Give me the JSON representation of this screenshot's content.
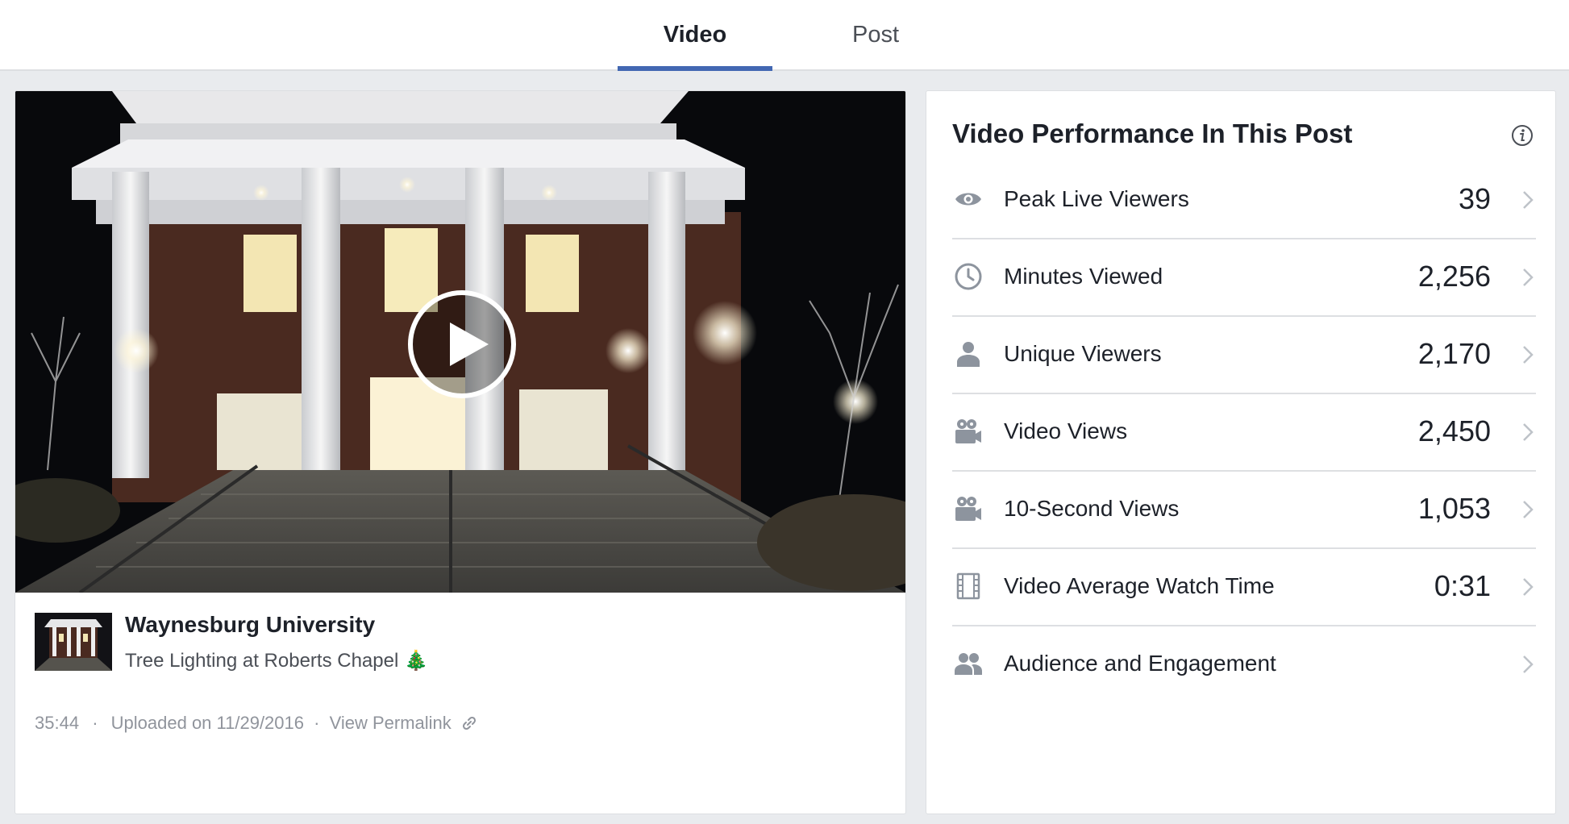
{
  "tabs": [
    {
      "label": "Video",
      "active": true
    },
    {
      "label": "Post",
      "active": false
    }
  ],
  "video": {
    "page_name": "Waynesburg University",
    "title": "Tree Lighting at Roberts Chapel 🎄",
    "duration": "35:44",
    "separator": "·",
    "uploaded": "Uploaded on 11/29/2016",
    "permalink": "View Permalink"
  },
  "performance": {
    "title": "Video Performance In This Post",
    "metrics": [
      {
        "label": "Peak Live Viewers",
        "value": "39",
        "icon": "eye-icon"
      },
      {
        "label": "Minutes Viewed",
        "value": "2,256",
        "icon": "clock-icon"
      },
      {
        "label": "Unique Viewers",
        "value": "2,170",
        "icon": "person-icon"
      },
      {
        "label": "Video Views",
        "value": "2,450",
        "icon": "video-camera-icon"
      },
      {
        "label": "10-Second Views",
        "value": "1,053",
        "icon": "video-camera-icon"
      },
      {
        "label": "Video Average Watch Time",
        "value": "0:31",
        "icon": "film-icon"
      },
      {
        "label": "Audience and Engagement",
        "value": "",
        "icon": "people-icon"
      }
    ]
  },
  "colors": {
    "accent": "#4267b2",
    "background": "#e9ebee",
    "text_primary": "#1d2129",
    "text_secondary": "#90949c",
    "icon_gray": "#8d949e"
  }
}
